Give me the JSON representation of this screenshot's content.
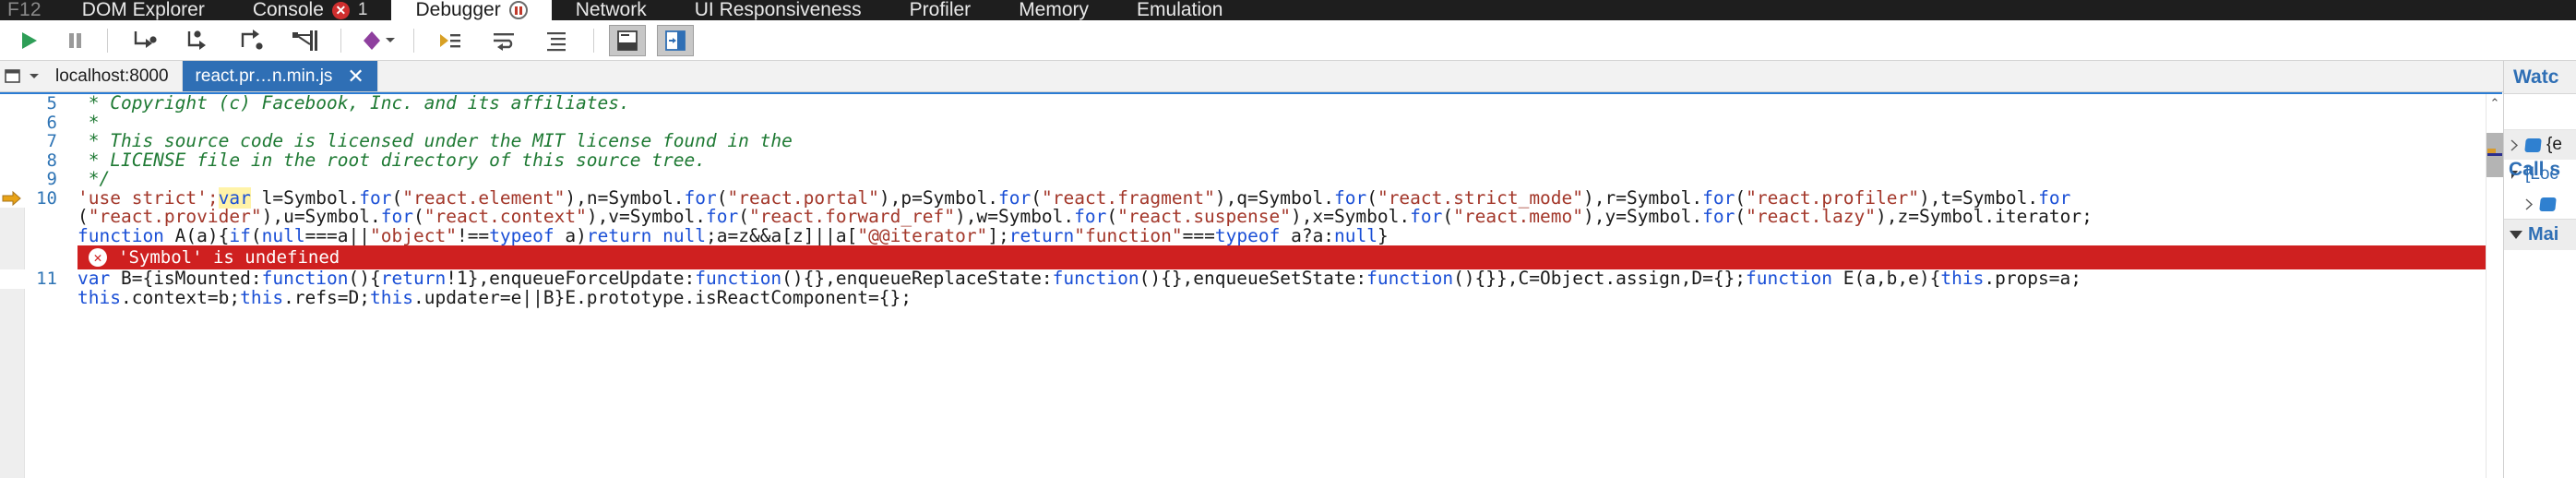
{
  "window": {
    "f12_label": "F12"
  },
  "tabs": [
    {
      "label": "DOM Explorer",
      "active": false,
      "badge": null,
      "badge_count": null,
      "glyph": null
    },
    {
      "label": "Console",
      "active": false,
      "badge": "error-badge",
      "badge_count": "1",
      "glyph": null
    },
    {
      "label": "Debugger",
      "active": true,
      "badge": null,
      "badge_count": null,
      "glyph": "paused-icon"
    },
    {
      "label": "Network",
      "active": false,
      "badge": null,
      "badge_count": null,
      "glyph": null
    },
    {
      "label": "UI Responsiveness",
      "active": false,
      "badge": null,
      "badge_count": null,
      "glyph": null
    },
    {
      "label": "Profiler",
      "active": false,
      "badge": null,
      "badge_count": null,
      "glyph": null
    },
    {
      "label": "Memory",
      "active": false,
      "badge": null,
      "badge_count": null,
      "glyph": null
    },
    {
      "label": "Emulation",
      "active": false,
      "badge": null,
      "badge_count": null,
      "glyph": null
    }
  ],
  "toolbar": {
    "buttons": [
      {
        "name": "continue-button",
        "title": "Continue",
        "icon": "play-icon"
      },
      {
        "name": "break-all-button",
        "title": "Break all",
        "icon": "pause-icon"
      },
      {
        "name": "step-into-button",
        "title": "Step into",
        "icon": "step-into-icon"
      },
      {
        "name": "step-over-button",
        "title": "Step over",
        "icon": "step-over-icon"
      },
      {
        "name": "step-out-button",
        "title": "Step out",
        "icon": "step-out-icon"
      },
      {
        "name": "break-on-new-worker-button",
        "title": "Break on new worker",
        "icon": "break-worker-icon"
      },
      {
        "name": "break-mode-button",
        "title": "Exception behavior",
        "icon": "break-exceptions-icon",
        "has_caret": true
      },
      {
        "name": "show-next-statement-button",
        "title": "Show next statement",
        "icon": "next-statement-icon"
      },
      {
        "name": "word-wrap-button",
        "title": "Word wrap",
        "icon": "word-wrap-icon"
      },
      {
        "name": "pretty-print-button",
        "title": "Pretty print",
        "icon": "pretty-print-icon"
      },
      {
        "name": "toggle-console-button",
        "title": "Show console",
        "icon": "console-split-icon",
        "pressed": true
      },
      {
        "name": "toggle-watch-button",
        "title": "Show watches",
        "icon": "watch-split-icon",
        "pressed": true
      }
    ]
  },
  "file_tabs": {
    "source_selector_icon": "source-dropdown-icon",
    "items": [
      {
        "label": "localhost:8000",
        "selected": false,
        "closable": false
      },
      {
        "label": "react.pr…n.min.js",
        "selected": true,
        "closable": true,
        "close_label": "✕"
      }
    ]
  },
  "code": {
    "lines": [
      {
        "number": "5",
        "breakpoint": false,
        "marker": false,
        "segments": [
          {
            "text": " * Copyright (c) Facebook, Inc. and its affiliates.",
            "cls": "s-com"
          }
        ]
      },
      {
        "number": "6",
        "breakpoint": false,
        "marker": false,
        "segments": [
          {
            "text": " *",
            "cls": "s-com"
          }
        ]
      },
      {
        "number": "7",
        "breakpoint": false,
        "marker": false,
        "segments": [
          {
            "text": " * This source code is licensed under the MIT license found in the",
            "cls": "s-com"
          }
        ]
      },
      {
        "number": "8",
        "breakpoint": false,
        "marker": false,
        "segments": [
          {
            "text": " * LICENSE file in the root directory of this source tree.",
            "cls": "s-com"
          }
        ]
      },
      {
        "number": "9",
        "breakpoint": false,
        "marker": false,
        "segments": [
          {
            "text": " */",
            "cls": "s-com"
          }
        ]
      },
      {
        "number": "10",
        "breakpoint": true,
        "marker": true,
        "segments": [
          {
            "text": "'use strict';",
            "cls": "s-str"
          },
          {
            "text": "var",
            "cls": "s-kw s-hl"
          },
          {
            "text": " l=Symbol.",
            "cls": "s-pl"
          },
          {
            "text": "for",
            "cls": "s-kw"
          },
          {
            "text": "(",
            "cls": "s-pl"
          },
          {
            "text": "\"react.element\"",
            "cls": "s-str"
          },
          {
            "text": "),n=Symbol.",
            "cls": "s-pl"
          },
          {
            "text": "for",
            "cls": "s-kw"
          },
          {
            "text": "(",
            "cls": "s-pl"
          },
          {
            "text": "\"react.portal\"",
            "cls": "s-str"
          },
          {
            "text": "),p=Symbol.",
            "cls": "s-pl"
          },
          {
            "text": "for",
            "cls": "s-kw"
          },
          {
            "text": "(",
            "cls": "s-pl"
          },
          {
            "text": "\"react.fragment\"",
            "cls": "s-str"
          },
          {
            "text": "),q=Symbol.",
            "cls": "s-pl"
          },
          {
            "text": "for",
            "cls": "s-kw"
          },
          {
            "text": "(",
            "cls": "s-pl"
          },
          {
            "text": "\"react.strict_mode\"",
            "cls": "s-str"
          },
          {
            "text": "),r=Symbol.",
            "cls": "s-pl"
          },
          {
            "text": "for",
            "cls": "s-kw"
          },
          {
            "text": "(",
            "cls": "s-pl"
          },
          {
            "text": "\"react.profiler\"",
            "cls": "s-str"
          },
          {
            "text": "),t=Symbol.",
            "cls": "s-pl"
          },
          {
            "text": "for",
            "cls": "s-kw"
          }
        ]
      },
      {
        "number": "",
        "breakpoint": false,
        "marker": false,
        "continuation": true,
        "segments": [
          {
            "text": "(",
            "cls": "s-pl"
          },
          {
            "text": "\"react.provider\"",
            "cls": "s-str"
          },
          {
            "text": "),u=Symbol.",
            "cls": "s-pl"
          },
          {
            "text": "for",
            "cls": "s-kw"
          },
          {
            "text": "(",
            "cls": "s-pl"
          },
          {
            "text": "\"react.context\"",
            "cls": "s-str"
          },
          {
            "text": "),v=Symbol.",
            "cls": "s-pl"
          },
          {
            "text": "for",
            "cls": "s-kw"
          },
          {
            "text": "(",
            "cls": "s-pl"
          },
          {
            "text": "\"react.forward_ref\"",
            "cls": "s-str"
          },
          {
            "text": "),w=Symbol.",
            "cls": "s-pl"
          },
          {
            "text": "for",
            "cls": "s-kw"
          },
          {
            "text": "(",
            "cls": "s-pl"
          },
          {
            "text": "\"react.suspense\"",
            "cls": "s-str"
          },
          {
            "text": "),x=Symbol.",
            "cls": "s-pl"
          },
          {
            "text": "for",
            "cls": "s-kw"
          },
          {
            "text": "(",
            "cls": "s-pl"
          },
          {
            "text": "\"react.memo\"",
            "cls": "s-str"
          },
          {
            "text": "),y=Symbol.",
            "cls": "s-pl"
          },
          {
            "text": "for",
            "cls": "s-kw"
          },
          {
            "text": "(",
            "cls": "s-pl"
          },
          {
            "text": "\"react.lazy\"",
            "cls": "s-str"
          },
          {
            "text": "),z=Symbol.iterator;",
            "cls": "s-pl"
          }
        ]
      },
      {
        "number": "",
        "breakpoint": false,
        "marker": false,
        "continuation": true,
        "segments": [
          {
            "text": "function",
            "cls": "s-kw"
          },
          {
            "text": " A(a){",
            "cls": "s-pl"
          },
          {
            "text": "if",
            "cls": "s-kw"
          },
          {
            "text": "(",
            "cls": "s-pl"
          },
          {
            "text": "null",
            "cls": "s-kw"
          },
          {
            "text": "===a||",
            "cls": "s-pl"
          },
          {
            "text": "\"object\"",
            "cls": "s-str"
          },
          {
            "text": "!==",
            "cls": "s-pl"
          },
          {
            "text": "typeof",
            "cls": "s-kw"
          },
          {
            "text": " a)",
            "cls": "s-pl"
          },
          {
            "text": "return",
            "cls": "s-kw"
          },
          {
            "text": " ",
            "cls": "s-pl"
          },
          {
            "text": "null",
            "cls": "s-kw"
          },
          {
            "text": ";a=z&&a[z]||a[",
            "cls": "s-pl"
          },
          {
            "text": "\"@@iterator\"",
            "cls": "s-str"
          },
          {
            "text": "];",
            "cls": "s-pl"
          },
          {
            "text": "return",
            "cls": "s-kw"
          },
          {
            "text": "\"function\"",
            "cls": "s-str"
          },
          {
            "text": "===",
            "cls": "s-pl"
          },
          {
            "text": "typeof",
            "cls": "s-kw"
          },
          {
            "text": " a?a:",
            "cls": "s-pl"
          },
          {
            "text": "null",
            "cls": "s-kw"
          },
          {
            "text": "}",
            "cls": "s-pl"
          }
        ]
      },
      {
        "number": "11",
        "breakpoint": false,
        "marker": false,
        "segments": [
          {
            "text": "var",
            "cls": "s-kw"
          },
          {
            "text": " B={isMounted:",
            "cls": "s-pl"
          },
          {
            "text": "function",
            "cls": "s-kw"
          },
          {
            "text": "(){",
            "cls": "s-pl"
          },
          {
            "text": "return",
            "cls": "s-kw"
          },
          {
            "text": "!1},enqueueForceUpdate:",
            "cls": "s-pl"
          },
          {
            "text": "function",
            "cls": "s-kw"
          },
          {
            "text": "(){},enqueueReplaceState:",
            "cls": "s-pl"
          },
          {
            "text": "function",
            "cls": "s-kw"
          },
          {
            "text": "(){},enqueueSetState:",
            "cls": "s-pl"
          },
          {
            "text": "function",
            "cls": "s-kw"
          },
          {
            "text": "(){}},C=Object.assign,D={};",
            "cls": "s-pl"
          },
          {
            "text": "function",
            "cls": "s-kw"
          },
          {
            "text": " E(a,b,e){",
            "cls": "s-pl"
          },
          {
            "text": "this",
            "cls": "s-kw"
          },
          {
            "text": ".props=a;",
            "cls": "s-pl"
          }
        ]
      },
      {
        "number": "",
        "breakpoint": false,
        "marker": false,
        "continuation": true,
        "segments": [
          {
            "text": "this",
            "cls": "s-kw"
          },
          {
            "text": ".context=b;",
            "cls": "s-pl"
          },
          {
            "text": "this",
            "cls": "s-kw"
          },
          {
            "text": ".refs=D;",
            "cls": "s-pl"
          },
          {
            "text": "this",
            "cls": "s-kw"
          },
          {
            "text": ".updater=e||B}E.prototype.isReactComponent={};",
            "cls": "s-pl"
          }
        ]
      }
    ]
  },
  "error_banner": {
    "icon": "error-circle-icon",
    "icon_glyph": "✕",
    "message": "'Symbol' is undefined",
    "color": "#cf2020"
  },
  "scrollbar": {
    "up_arrow": "⌃",
    "down_arrow": "⌄",
    "name": "code-vertical-scrollbar"
  },
  "right_panel": {
    "title": "Watc",
    "rows": [
      {
        "expander": "collapsed",
        "icon": "object-cube-icon",
        "text": "{e",
        "shaded": true,
        "indent": false
      },
      {
        "expander": "expanded",
        "icon": null,
        "text": "[Loc",
        "shaded": false,
        "indent": false
      },
      {
        "expander": "collapsed",
        "icon": "object-cube-icon",
        "text": "",
        "shaded": false,
        "indent": true
      }
    ],
    "section": {
      "expander": "expanded",
      "text": "Mai"
    }
  },
  "panes": {
    "call_stack_label": "Call s"
  }
}
